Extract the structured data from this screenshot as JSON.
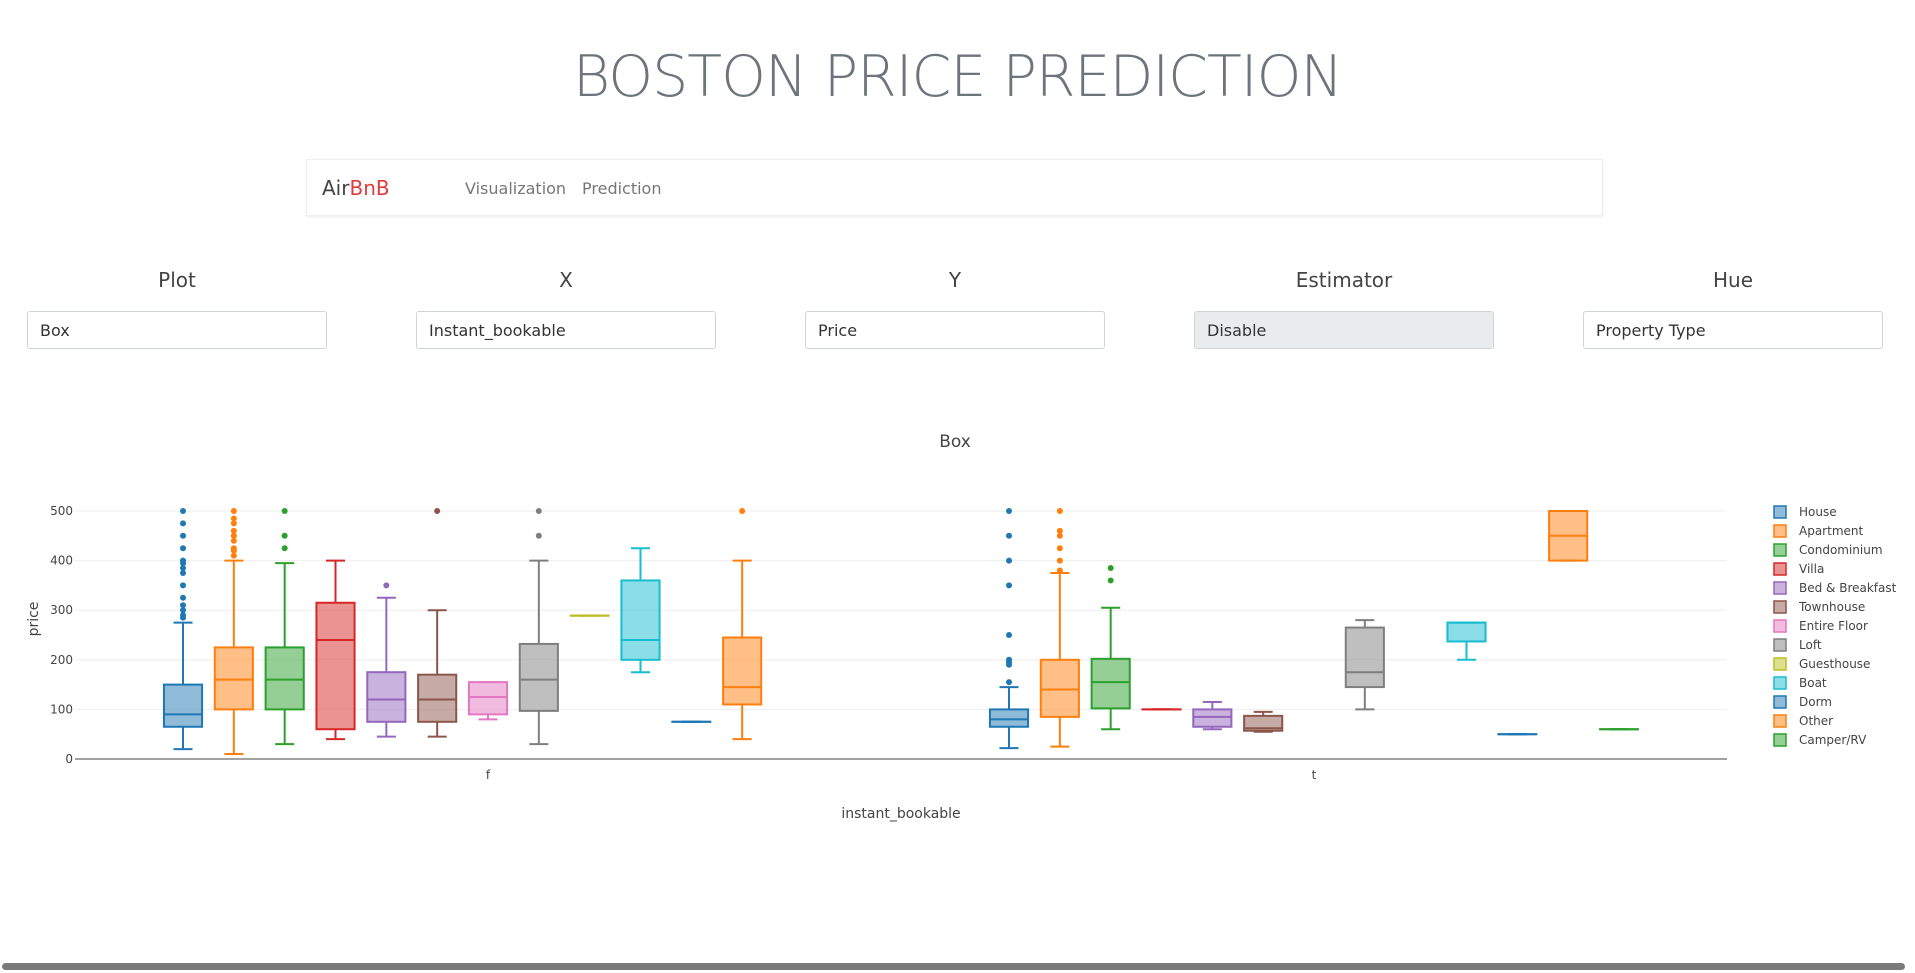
{
  "page": {
    "title": "BOSTON PRICE PREDICTION"
  },
  "navbar": {
    "brand_part1": "Air",
    "brand_part2": "BnB",
    "links": [
      "Visualization",
      "Prediction"
    ]
  },
  "controls": [
    {
      "label": "Plot",
      "value": "Box",
      "disabled": false
    },
    {
      "label": "X",
      "value": "Instant_bookable",
      "disabled": false
    },
    {
      "label": "Y",
      "value": "Price",
      "disabled": false
    },
    {
      "label": "Estimator",
      "value": "Disable",
      "disabled": true
    },
    {
      "label": "Hue",
      "value": "Property Type",
      "disabled": false
    }
  ],
  "chart_data": {
    "type": "box",
    "title": "Box",
    "xlabel": "instant_bookable",
    "ylabel": "price",
    "categories": [
      "f",
      "t"
    ],
    "ylim": [
      0,
      520
    ],
    "yticks": [
      0,
      100,
      200,
      300,
      400,
      500
    ],
    "grid": true,
    "legend_position": "right",
    "series": [
      {
        "name": "House",
        "color": "#1f77b4",
        "boxes": {
          "f": {
            "q1": 65,
            "median": 90,
            "q3": 150,
            "low": 20,
            "high": 275,
            "outliers": [
              285,
              290,
              300,
              310,
              325,
              350,
              375,
              385,
              395,
              400,
              425,
              450,
              475,
              500
            ]
          },
          "t": {
            "q1": 65,
            "median": 80,
            "q3": 100,
            "low": 22,
            "high": 145,
            "outliers": [
              155,
              190,
              195,
              200,
              250,
              350,
              400,
              450,
              500
            ]
          }
        }
      },
      {
        "name": "Apartment",
        "color": "#ff7f0e",
        "boxes": {
          "f": {
            "q1": 100,
            "median": 160,
            "q3": 225,
            "low": 10,
            "high": 400,
            "outliers": [
              410,
              420,
              425,
              440,
              450,
              460,
              475,
              485,
              500
            ]
          },
          "t": {
            "q1": 85,
            "median": 140,
            "q3": 200,
            "low": 25,
            "high": 375,
            "outliers": [
              380,
              400,
              425,
              450,
              460,
              500
            ]
          }
        }
      },
      {
        "name": "Condominium",
        "color": "#2ca02c",
        "boxes": {
          "f": {
            "q1": 100,
            "median": 160,
            "q3": 225,
            "low": 30,
            "high": 395,
            "outliers": [
              425,
              450,
              500
            ]
          },
          "t": {
            "q1": 102,
            "median": 155,
            "q3": 202,
            "low": 60,
            "high": 305,
            "outliers": [
              360,
              385
            ]
          }
        }
      },
      {
        "name": "Villa",
        "color": "#d62728",
        "boxes": {
          "f": {
            "q1": 60,
            "median": 240,
            "q3": 315,
            "low": 40,
            "high": 400,
            "outliers": []
          },
          "t": {
            "q1": 100,
            "median": 100,
            "q3": 100,
            "low": 100,
            "high": 100,
            "outliers": []
          }
        }
      },
      {
        "name": "Bed & Breakfast",
        "color": "#9467bd",
        "boxes": {
          "f": {
            "q1": 75,
            "median": 120,
            "q3": 175,
            "low": 45,
            "high": 325,
            "outliers": [
              350
            ]
          },
          "t": {
            "q1": 65,
            "median": 85,
            "q3": 100,
            "low": 60,
            "high": 115,
            "outliers": []
          }
        }
      },
      {
        "name": "Townhouse",
        "color": "#8c564b",
        "boxes": {
          "f": {
            "q1": 75,
            "median": 120,
            "q3": 170,
            "low": 45,
            "high": 300,
            "outliers": [
              500
            ]
          },
          "t": {
            "q1": 57,
            "median": 62,
            "q3": 87,
            "low": 55,
            "high": 95,
            "outliers": []
          }
        }
      },
      {
        "name": "Entire Floor",
        "color": "#e377c2",
        "boxes": {
          "f": {
            "q1": 90,
            "median": 125,
            "q3": 155,
            "low": 80,
            "high": 155,
            "outliers": []
          }
        }
      },
      {
        "name": "Loft",
        "color": "#7f7f7f",
        "boxes": {
          "f": {
            "q1": 97,
            "median": 160,
            "q3": 232,
            "low": 30,
            "high": 400,
            "outliers": [
              450,
              500
            ]
          },
          "t": {
            "q1": 145,
            "median": 175,
            "q3": 265,
            "low": 100,
            "high": 280,
            "outliers": []
          }
        }
      },
      {
        "name": "Guesthouse",
        "color": "#bcbd22",
        "boxes": {
          "f": {
            "q1": 289,
            "median": 289,
            "q3": 289,
            "low": 289,
            "high": 289,
            "outliers": []
          }
        }
      },
      {
        "name": "Boat",
        "color": "#17becf",
        "boxes": {
          "f": {
            "q1": 200,
            "median": 240,
            "q3": 360,
            "low": 175,
            "high": 425,
            "outliers": []
          },
          "t": {
            "q1": 237,
            "median": 275,
            "q3": 275,
            "low": 200,
            "high": 275,
            "outliers": []
          }
        }
      },
      {
        "name": "Dorm",
        "color": "#1f77b4",
        "boxes": {
          "f": {
            "q1": 75,
            "median": 75,
            "q3": 75,
            "low": 75,
            "high": 75,
            "outliers": []
          },
          "t": {
            "q1": 50,
            "median": 50,
            "q3": 50,
            "low": 50,
            "high": 50,
            "outliers": []
          }
        }
      },
      {
        "name": "Other",
        "color": "#ff7f0e",
        "boxes": {
          "f": {
            "q1": 110,
            "median": 145,
            "q3": 245,
            "low": 40,
            "high": 400,
            "outliers": [
              500
            ]
          },
          "t": {
            "q1": 400,
            "median": 450,
            "q3": 500,
            "low": 400,
            "high": 500,
            "outliers": []
          }
        }
      },
      {
        "name": "Camper/RV",
        "color": "#2ca02c",
        "boxes": {
          "t": {
            "q1": 60,
            "median": 60,
            "q3": 60,
            "low": 60,
            "high": 60,
            "outliers": []
          }
        }
      }
    ]
  }
}
